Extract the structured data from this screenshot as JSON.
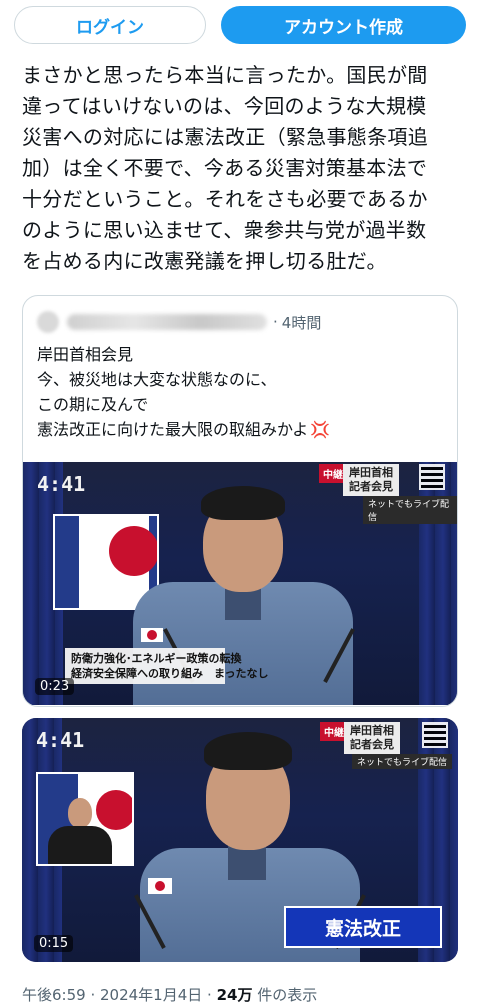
{
  "header": {
    "login_label": "ログイン",
    "signup_label": "アカウント作成"
  },
  "tweet": {
    "text": "まさかと思ったら本当に言ったか。国民が間\n違ってはいけないのは、今回のような大規模\n災害への対応には憲法改正（緊急事態条項追\n加）は全く不要で、今ある災害対策基本法で\n十分だということ。それをさも必要であるか\nのように思い込ませて、衆参共与党が過半数\nを占める内に改憲発議を押し切る肚だ。"
  },
  "quote": {
    "separator": "·",
    "time": "4時間",
    "text": "岸田首相会見\n今、被災地は大変な状態なのに、\nこの期に及んで\n憲法改正に向けた最大限の取組みかよ",
    "emoji": "anger-symbol",
    "video": {
      "clock": "4:41",
      "badge": "中継",
      "caption": "岸田首相\n記者会見",
      "caption_sub": "ネットでもライブ配信",
      "lower_third": "防衛力強化･エネルギー政策の転換\n経済安全保障への取り組み　まったなし",
      "duration": "0:23"
    }
  },
  "media2": {
    "clock": "4:41",
    "badge": "中継",
    "caption": "岸田首相\n記者会見",
    "caption_sub": "ネットでもライブ配信",
    "label": "憲法改正",
    "duration": "0:15"
  },
  "footer": {
    "time": "午後6:59",
    "separator": " · ",
    "date": "2024年1月4日",
    "views_count": "24万",
    "views_label": " 件の表示"
  },
  "colors": {
    "accent": "#1d9bf0",
    "news_red": "#c8102e",
    "label_blue": "#1436b8"
  }
}
